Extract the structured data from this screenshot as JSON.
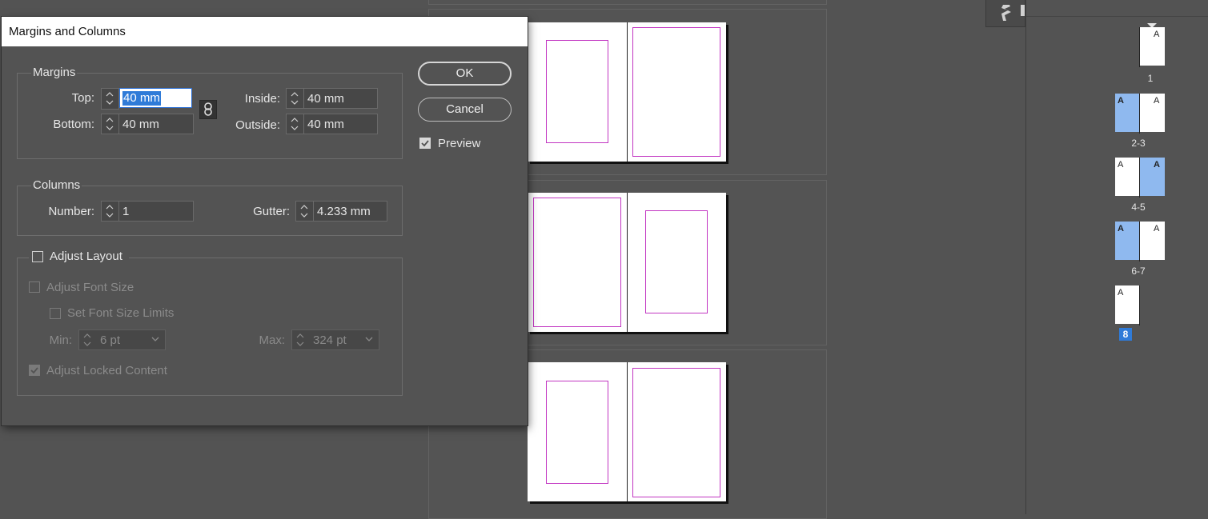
{
  "dialog": {
    "title": "Margins and Columns",
    "margins": {
      "group_label": "Margins",
      "top_label": "Top:",
      "top_value": "40 mm",
      "bottom_label": "Bottom:",
      "bottom_value": "40 mm",
      "inside_label": "Inside:",
      "inside_value": "40 mm",
      "outside_label": "Outside:",
      "outside_value": "40 mm"
    },
    "columns": {
      "group_label": "Columns",
      "number_label": "Number:",
      "number_value": "1",
      "gutter_label": "Gutter:",
      "gutter_value": "4.233 mm"
    },
    "adjust_layout": {
      "label": "Adjust Layout",
      "checked": false,
      "adjust_font_size_label": "Adjust Font Size",
      "set_font_size_limits_label": "Set Font Size Limits",
      "min_label": "Min:",
      "min_value": "6 pt",
      "max_label": "Max:",
      "max_value": "324 pt",
      "adjust_locked_content_label": "Adjust Locked Content",
      "adjust_locked_content_checked": true
    },
    "buttons": {
      "ok": "OK",
      "cancel": "Cancel"
    },
    "preview": {
      "label": "Preview",
      "checked": true
    }
  },
  "pages_panel": {
    "master_letter": "A",
    "entries": [
      {
        "label": "1",
        "left": "",
        "right": "A",
        "selected": []
      },
      {
        "label": "2-3",
        "left": "A",
        "right": "A",
        "selected": [
          "left"
        ]
      },
      {
        "label": "4-5",
        "left": "A",
        "right": "A",
        "selected": [
          "right"
        ]
      },
      {
        "label": "6-7",
        "left": "A",
        "right": "A",
        "selected": [
          "left"
        ]
      },
      {
        "label": "8",
        "left": "A",
        "right": "",
        "selected": [],
        "current": true
      }
    ]
  },
  "colors": {
    "accent": "#2f7bd8",
    "margin_guide": "#c236c2",
    "selected_page": "#8fb9ef"
  }
}
